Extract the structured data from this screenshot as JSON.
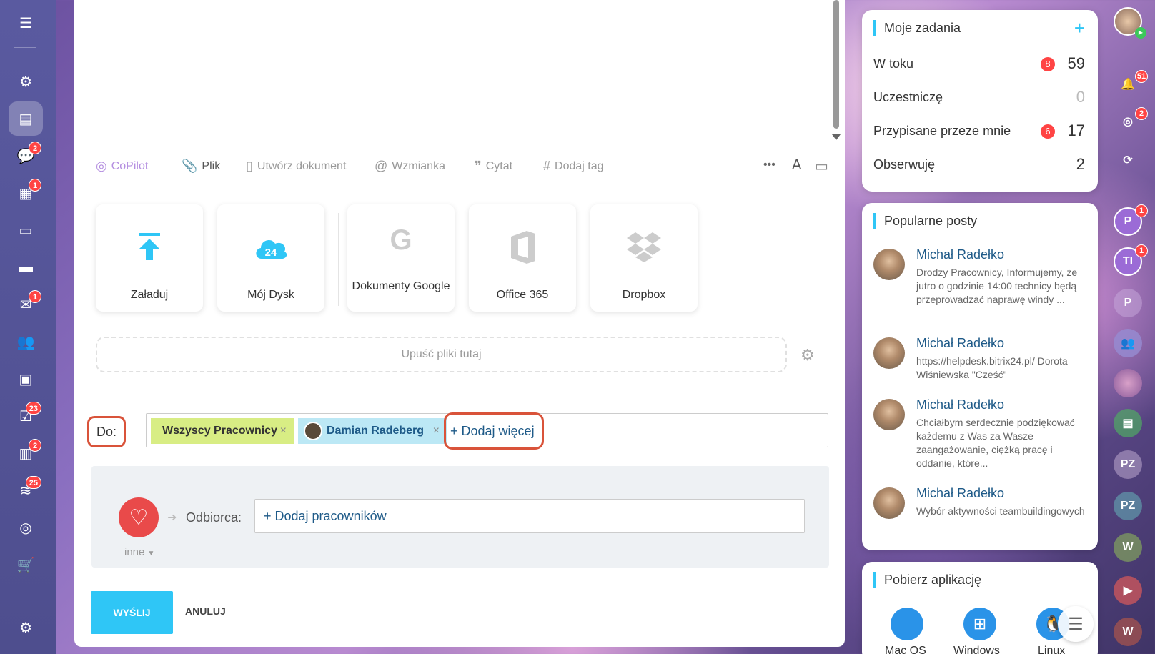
{
  "toolbar": {
    "copilot": "CoPilot",
    "file": "Plik",
    "create_doc": "Utwórz dokument",
    "mention": "Wzmianka",
    "quote": "Cytat",
    "add_tag": "Dodaj tag",
    "font": "A"
  },
  "tiles": [
    {
      "label": "Załaduj"
    },
    {
      "label": "Mój Dysk"
    },
    {
      "label": "Dokumenty Google"
    },
    {
      "label": "Office 365"
    },
    {
      "label": "Dropbox"
    }
  ],
  "drop": {
    "text": "Upuść pliki tutaj"
  },
  "recipients": {
    "to_label": "Do:",
    "chips": [
      "Wszyscy Pracownicy",
      "Damian Radeberg"
    ],
    "add_more": "+ Dodaj więcej"
  },
  "kudos": {
    "type": "inne",
    "recipient_label": "Odbiorca:",
    "add_employees": "+ Dodaj pracowników"
  },
  "actions": {
    "send": "WYŚLIJ",
    "cancel": "ANULUJ"
  },
  "tasks": {
    "title": "Moje zadania",
    "rows": [
      {
        "label": "W toku",
        "badge": "8",
        "count": "59"
      },
      {
        "label": "Uczestniczę",
        "badge": "",
        "count": "0"
      },
      {
        "label": "Przypisane przeze mnie",
        "badge": "6",
        "count": "17"
      },
      {
        "label": "Obserwuję",
        "badge": "",
        "count": "2"
      }
    ]
  },
  "popular": {
    "title": "Popularne posty",
    "posts": [
      {
        "author": "Michał Radełko",
        "text": "Drodzy Pracownicy, Informujemy, że jutro o godzinie 14:00 technicy będą przeprowadzać naprawę windy ..."
      },
      {
        "author": "Michał Radełko",
        "text": "https://helpdesk.bitrix24.pl/ Dorota Wiśniewska \"Cześć\""
      },
      {
        "author": "Michał Radełko",
        "text": "Chciałbym serdecznie podziękować każdemu z Was za Wasze zaangażowanie, ciężką pracę i oddanie, które..."
      },
      {
        "author": "Michał Radełko",
        "text": "Wybór aktywności teambuildingowych"
      }
    ]
  },
  "apps": {
    "title": "Pobierz aplikację",
    "items": [
      "Mac OS",
      "Windows",
      "Linux"
    ]
  },
  "left_badges": {
    "chat": "2",
    "calendar": "1",
    "mail": "1",
    "tasks": "23",
    "crm": "2",
    "filter": "25"
  },
  "right_badges": {
    "notifications": "51",
    "activity": "2",
    "p": "1",
    "ti": "1"
  },
  "right_avatars": {
    "p": "P",
    "ti": "TI",
    "p2": "P",
    "pz1": "PZ",
    "pz2": "PZ",
    "w1": "W",
    "w2": "W"
  },
  "drive_logo": "24"
}
